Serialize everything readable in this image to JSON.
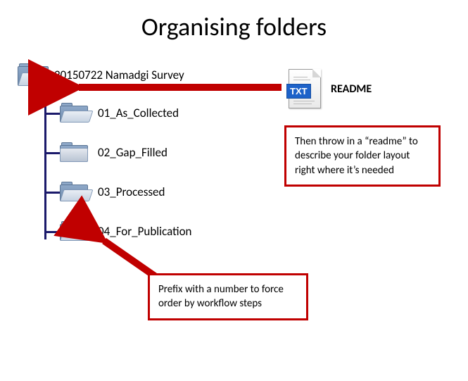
{
  "title": "Organising folders",
  "tree": {
    "root_label": "20150722 Namadgi Survey",
    "children": [
      {
        "label": "01_As_Collected"
      },
      {
        "label": "02_Gap_Filled"
      },
      {
        "label": "03_Processed"
      },
      {
        "label": "04_For_Publication"
      }
    ]
  },
  "readme": {
    "file_badge": "TXT",
    "label": "README"
  },
  "callouts": {
    "readme_tip": "Then throw in a “readme” to describe your folder layout right where it’s needed",
    "prefix_tip": "Prefix with a number to force order by workflow steps"
  },
  "arrow_color": "#c00000",
  "tree_line_color": "#1b1a6b"
}
